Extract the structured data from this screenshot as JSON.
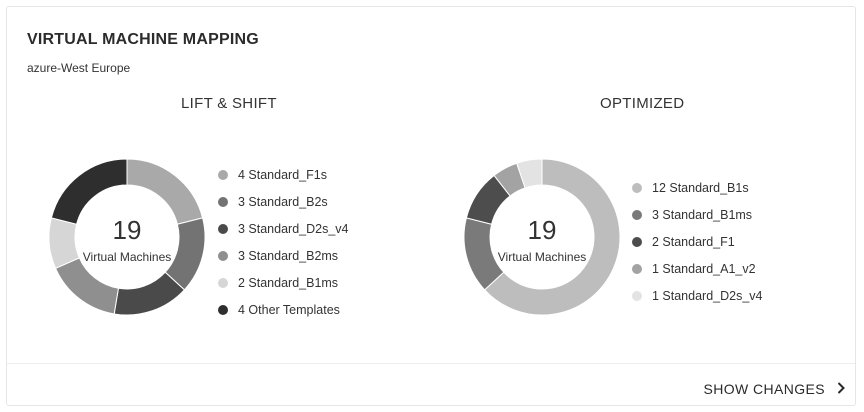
{
  "card": {
    "title": "VIRTUAL MACHINE MAPPING",
    "subtitle": "azure-West Europe"
  },
  "lift_shift": {
    "heading": "LIFT & SHIFT",
    "center_value": "19",
    "center_label": "Virtual Machines",
    "legend": [
      {
        "label": "4 Standard_F1s",
        "color": "#a9a9a9"
      },
      {
        "label": "3 Standard_B2s",
        "color": "#737373"
      },
      {
        "label": "3 Standard_D2s_v4",
        "color": "#4a4a4a"
      },
      {
        "label": "3 Standard_B2ms",
        "color": "#8f8f8f"
      },
      {
        "label": "2 Standard_B1ms",
        "color": "#d6d6d6"
      },
      {
        "label": "4 Other Templates",
        "color": "#2e2e2e"
      }
    ]
  },
  "optimized": {
    "heading": "OPTIMIZED",
    "center_value": "19",
    "center_label": "Virtual Machines",
    "legend": [
      {
        "label": "12 Standard_B1s",
        "color": "#bdbdbd"
      },
      {
        "label": "3 Standard_B1ms",
        "color": "#7a7a7a"
      },
      {
        "label": "2 Standard_F1",
        "color": "#4d4d4d"
      },
      {
        "label": "1 Standard_A1_v2",
        "color": "#a3a3a3"
      },
      {
        "label": "1 Standard_D2s_v4",
        "color": "#e3e3e3"
      }
    ]
  },
  "chart_data": [
    {
      "type": "pie",
      "title": "LIFT & SHIFT",
      "categories": [
        "Standard_F1s",
        "Standard_B2s",
        "Standard_D2s_v4",
        "Standard_B2ms",
        "Standard_B1ms",
        "Other Templates"
      ],
      "values": [
        4,
        3,
        3,
        3,
        2,
        4
      ],
      "colors": [
        "#a9a9a9",
        "#737373",
        "#4a4a4a",
        "#8f8f8f",
        "#d6d6d6",
        "#2e2e2e"
      ]
    },
    {
      "type": "pie",
      "title": "OPTIMIZED",
      "categories": [
        "Standard_B1s",
        "Standard_B1ms",
        "Standard_F1",
        "Standard_A1_v2",
        "Standard_D2s_v4"
      ],
      "values": [
        12,
        3,
        2,
        1,
        1
      ],
      "colors": [
        "#bdbdbd",
        "#7a7a7a",
        "#4d4d4d",
        "#a3a3a3",
        "#e3e3e3"
      ]
    }
  ],
  "footer": {
    "action_label": "SHOW CHANGES",
    "action_icon": "chevron-right-icon"
  }
}
